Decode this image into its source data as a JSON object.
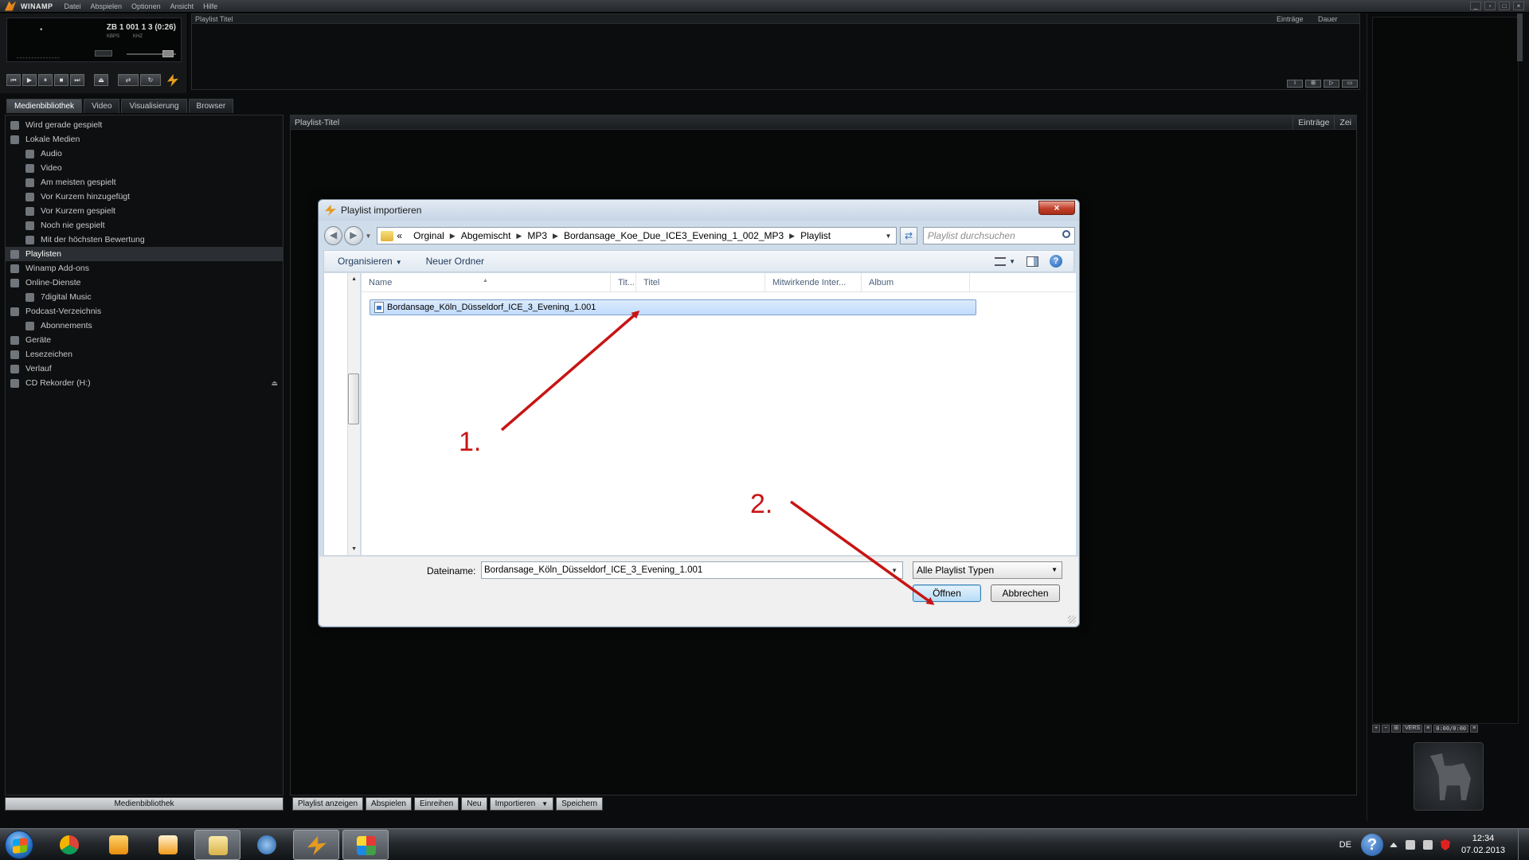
{
  "winamp": {
    "app_name": "WINAMP",
    "menu": [
      "Datei",
      "Abspielen",
      "Optionen",
      "Ansicht",
      "Hilfe"
    ],
    "window_buttons": [
      "_",
      "▫",
      "□",
      "×"
    ],
    "player": {
      "time": "•\n•",
      "song": "ZB 1 001 1 3 (0:26)",
      "kbps_label": "KBPS",
      "khz_label": "KHZ",
      "vis": "---------------"
    },
    "top_playlist": {
      "title": "Playlist Titel",
      "col_entries": "Einträge",
      "col_duration": "Dauer"
    },
    "tabs": [
      "Medienbibliothek",
      "Video",
      "Visualisierung",
      "Browser"
    ],
    "tree": [
      {
        "label": "Wird gerade gespielt",
        "indent": 0
      },
      {
        "label": "Lokale Medien",
        "indent": 0,
        "expanded": true
      },
      {
        "label": "Audio",
        "indent": 1
      },
      {
        "label": "Video",
        "indent": 1
      },
      {
        "label": "Am meisten gespielt",
        "indent": 1
      },
      {
        "label": "Vor Kurzem hinzugefügt",
        "indent": 1
      },
      {
        "label": "Vor Kurzem gespielt",
        "indent": 1
      },
      {
        "label": "Noch nie gespielt",
        "indent": 1
      },
      {
        "label": "Mit der höchsten Bewertung",
        "indent": 1
      },
      {
        "label": "Playlisten",
        "indent": 0,
        "selected": true
      },
      {
        "label": "Winamp Add-ons",
        "indent": 0
      },
      {
        "label": "Online-Dienste",
        "indent": 0,
        "expanded": true
      },
      {
        "label": "7digital Music",
        "indent": 1
      },
      {
        "label": "Podcast-Verzeichnis",
        "indent": 0,
        "expanded": true
      },
      {
        "label": "Abonnements",
        "indent": 1
      },
      {
        "label": "Geräte",
        "indent": 0
      },
      {
        "label": "Lesezeichen",
        "indent": 0
      },
      {
        "label": "Verlauf",
        "indent": 0
      },
      {
        "label": "CD Rekorder (H:)",
        "indent": 0
      }
    ],
    "library_button": "Medienbibliothek",
    "main_header": {
      "title": "Playlist-Titel",
      "col_entries": "Einträge",
      "col_time": "Zei"
    },
    "main_buttons": [
      "Playlist anzeigen",
      "Abspielen",
      "Einreihen",
      "Neu",
      "Importieren",
      "Speichern"
    ],
    "right_buttons": [
      "+",
      "−",
      "⊞",
      "VERS",
      "≡",
      "0:00/0:00",
      "≡"
    ]
  },
  "dialog": {
    "title": "Playlist importieren",
    "close": "×",
    "breadcrumb": [
      "«",
      "Orginal",
      "Abgemischt",
      "MP3",
      "Bordansage_Koe_Due_ICE3_Evening_1_002_MP3",
      "Playlist"
    ],
    "search_placeholder": "Playlist durchsuchen",
    "toolbar": {
      "organize": "Organisieren",
      "new_folder": "Neuer Ordner",
      "help": "?"
    },
    "columns": [
      "Name",
      "Tit...",
      "Titel",
      "Mitwirkende Inter...",
      "Album"
    ],
    "file": "Bordansage_Köln_Düsseldorf_ICE_3_Evening_1.001",
    "filename_label": "Dateiname:",
    "filename_value": "Bordansage_Köln_Düsseldorf_ICE_3_Evening_1.001",
    "file_type": "Alle Playlist Typen",
    "open": "Öffnen",
    "cancel": "Abbrechen"
  },
  "annotations": {
    "step1": "1.",
    "step2": "2.",
    "color": "#c81414"
  },
  "taskbar": {
    "lang": "DE",
    "time": "12:34",
    "date": "07.02.2013"
  }
}
